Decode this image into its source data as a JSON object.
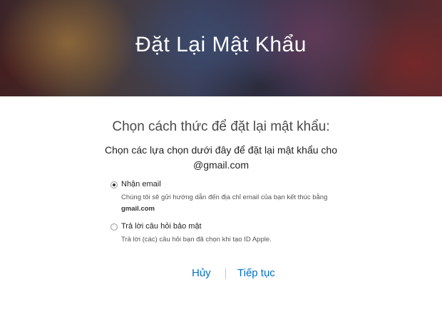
{
  "banner": {
    "title": "Đặt Lại Mật Khẩu"
  },
  "main": {
    "heading": "Chọn cách thức để đặt lại mật khẩu:",
    "subheading_line1": "Chọn các lựa chọn dưới đây để đặt lại mật khẩu cho",
    "subheading_line2": "@gmail.com"
  },
  "options": [
    {
      "label": "Nhận email",
      "description": "Chúng tôi sẽ gửi hướng dẫn đến địa chỉ email của bạn kết thúc bằng",
      "description_bold": "gmail.com",
      "selected": true
    },
    {
      "label": "Trả lời câu hỏi bảo mật",
      "description": "Trả lời (các) câu hỏi bạn đã chọn khi tạo ID Apple.",
      "selected": false
    }
  ],
  "actions": {
    "cancel_label": "Hủy",
    "continue_label": "Tiếp tục"
  },
  "colors": {
    "link": "#0070c9",
    "heading_text": "#4a4a4a"
  }
}
